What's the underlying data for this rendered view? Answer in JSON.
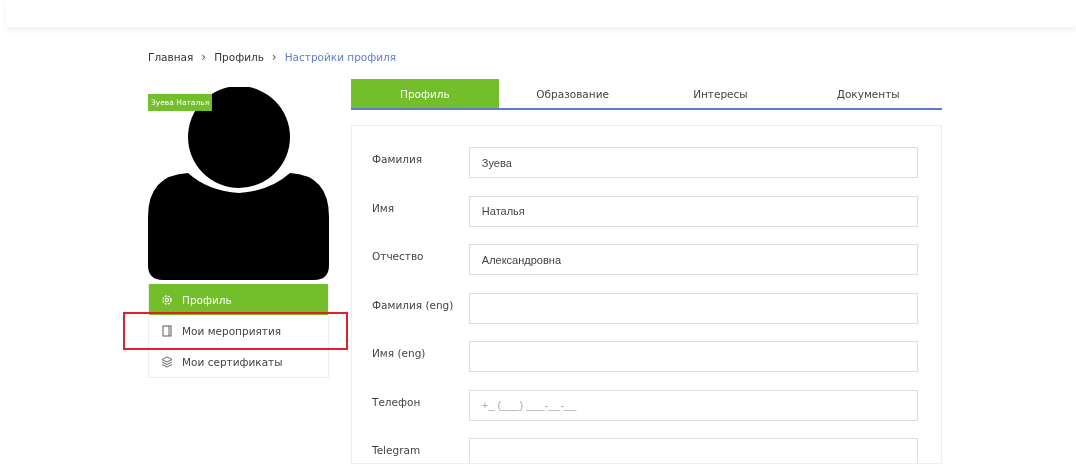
{
  "breadcrumb": [
    {
      "label": "Главная",
      "current": false
    },
    {
      "label": "Профиль",
      "current": false
    },
    {
      "label": "Настройки профиля",
      "current": true
    }
  ],
  "breadcrumb_separator": "›",
  "user": {
    "name": "Зуева Наталья"
  },
  "menu": [
    {
      "label": "Профиль",
      "selected": true,
      "highlighted": false
    },
    {
      "label": "Мои мероприятия",
      "selected": false,
      "highlighted": true
    },
    {
      "label": "Мои сертификаты",
      "selected": false,
      "highlighted": false
    }
  ],
  "tabs": [
    {
      "label": "Профиль",
      "selected": true
    },
    {
      "label": "Образование",
      "selected": false
    },
    {
      "label": "Интересы",
      "selected": false
    },
    {
      "label": "Документы",
      "selected": false
    }
  ],
  "fields": [
    {
      "label": "Фамилия",
      "value": "Зуева"
    },
    {
      "label": "Имя",
      "value": "Наталья"
    },
    {
      "label": "Отчество",
      "value": "Александровна"
    },
    {
      "label": "Фамилия (eng)"
    },
    {
      "label": "Имя (eng)"
    },
    {
      "label": "Телефон",
      "placeholder": "+_ (___) ___-__-__"
    },
    {
      "label": "Telegram"
    }
  ]
}
